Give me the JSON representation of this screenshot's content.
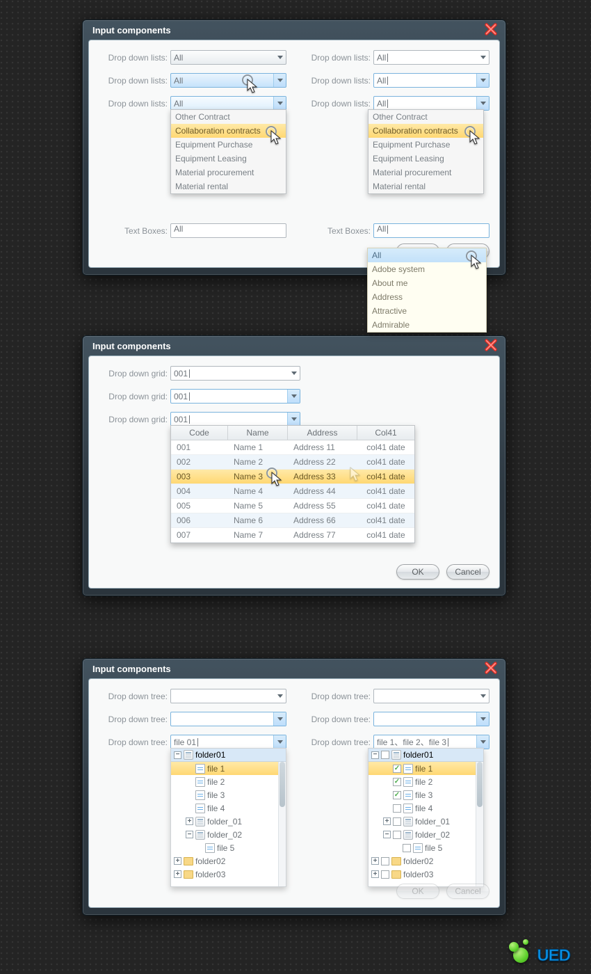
{
  "panel1": {
    "title": "Input components",
    "labels": {
      "dropdown": "Drop down lists:",
      "textbox": "Text Boxes:"
    },
    "value_all": "All",
    "options": [
      "Other Contract",
      "Collaboration contracts",
      "Equipment Purchase",
      "Equipment Leasing",
      "Material procurement",
      "Material rental"
    ],
    "ac_options": [
      "All",
      "Adobe system",
      "About me",
      "Address",
      "Attractive",
      "Admirable"
    ]
  },
  "panel2": {
    "title": "Input components",
    "label": "Drop down grid:",
    "value": "001",
    "cols": [
      "Code",
      "Name",
      "Address",
      "Col41"
    ],
    "rows": [
      {
        "c": "001",
        "n": "Name 1",
        "a": "Address 11",
        "d": "col41 date"
      },
      {
        "c": "002",
        "n": "Name 2",
        "a": "Address 22",
        "d": "col41 date"
      },
      {
        "c": "003",
        "n": "Name 3",
        "a": "Address 33",
        "d": "col41 date"
      },
      {
        "c": "004",
        "n": "Name 4",
        "a": "Address 44",
        "d": "col41 date"
      },
      {
        "c": "005",
        "n": "Name 5",
        "a": "Address 55",
        "d": "col41 date"
      },
      {
        "c": "006",
        "n": "Name 6",
        "a": "Address 66",
        "d": "col41 date"
      },
      {
        "c": "007",
        "n": "Name 7",
        "a": "Address 77",
        "d": "col41 date"
      }
    ],
    "ok": "OK",
    "cancel": "Cancel"
  },
  "panel3": {
    "title": "Input components",
    "label": "Drop down tree:",
    "value_single": "file 01",
    "value_multi": "file 1、file 2、file 3",
    "nodes": {
      "folder01": "folder01",
      "file1": "file 1",
      "file2": "file 2",
      "file3": "file 3",
      "file4": "file 4",
      "folder_01": "folder_01",
      "folder_02": "folder_02",
      "file5": "file 5",
      "folder02": "folder02",
      "folder03": "folder03"
    }
  },
  "logo": "UED"
}
